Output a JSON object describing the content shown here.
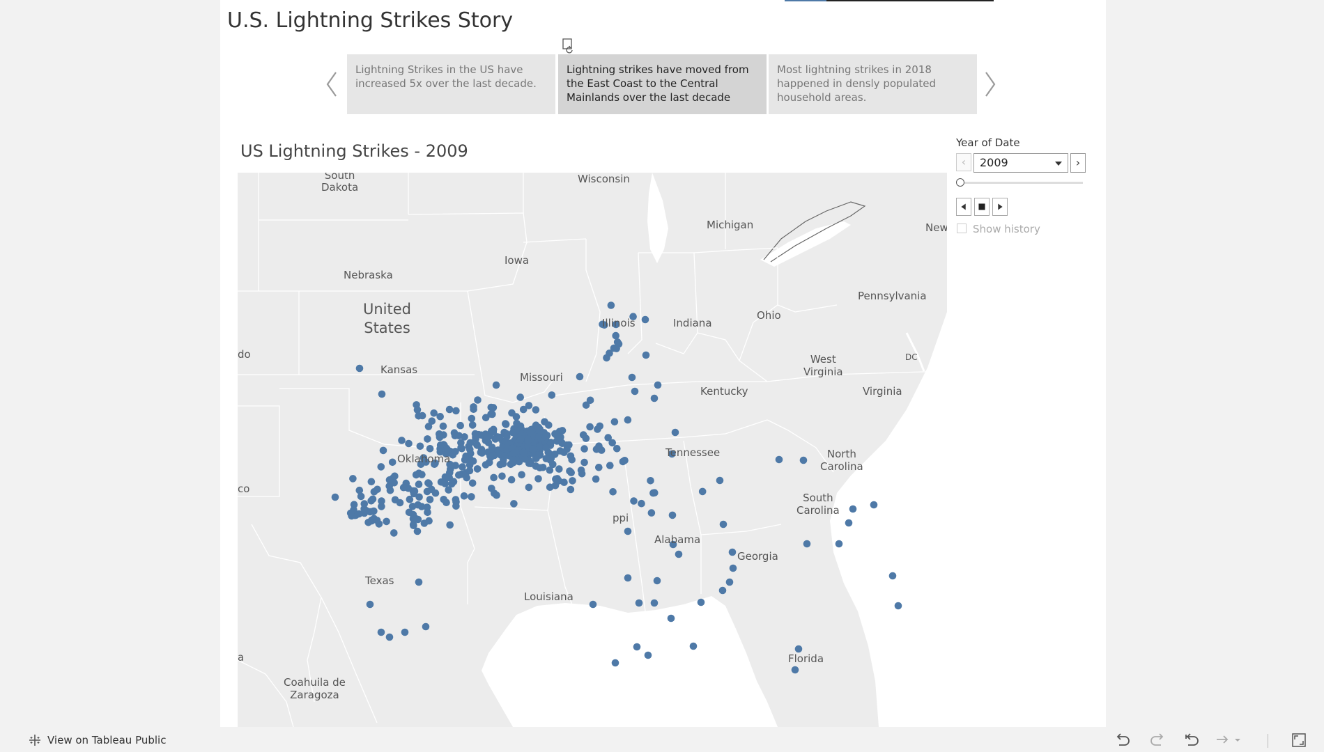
{
  "story": {
    "title": "U.S. Lightning Strikes Story",
    "progress_fraction": 0.2,
    "story_points": [
      {
        "text": "Lightning Strikes in the US have increased 5x over the last decade.",
        "active": false
      },
      {
        "text": "Lightning strikes have moved from the East Coast to the Central Mainlands over the last decade",
        "active": true
      },
      {
        "text": "Most lightning strikes in 2018 happened in densly populated household areas.",
        "active": false
      }
    ]
  },
  "sheet": {
    "title": "US Lightning Strikes - 2009",
    "marker_color": "#4e79a7"
  },
  "map_labels": {
    "south_dakota": "South\nDakota",
    "wisconsin": "Wisconsin",
    "michigan": "Michigan",
    "new_york": "New",
    "iowa": "Iowa",
    "nebraska": "Nebraska",
    "united_states": "United\nStates",
    "pennsylvania": "Pennsylvania",
    "illinois": "Illinois",
    "indiana": "Indiana",
    "ohio": "Ohio",
    "colorado": "do",
    "kansas": "Kansas",
    "missouri": "Missouri",
    "west_virginia": "West\nVirginia",
    "dc": "DC",
    "kentucky": "Kentucky",
    "virginia": "Virginia",
    "tennessee": "Tennessee",
    "north_carolina": "North\nCarolina",
    "oklahoma": "Oklahoma",
    "new_mexico": "co",
    "south_carolina": "South\nCarolina",
    "mississippi": "ppi",
    "alabama": "Alabama",
    "georgia": "Georgia",
    "texas": "Texas",
    "louisiana": "Louisiana",
    "florida": "Florida",
    "arizona": "a",
    "coahuila": "Coahuila de\nZaragoza"
  },
  "filter": {
    "label": "Year of Date",
    "value": "2009",
    "prev_symbol": "‹",
    "next_symbol": "›",
    "slider_fraction": 0,
    "show_history_label": "Show history",
    "show_history_checked": false
  },
  "footer": {
    "tableau_label": "View on Tableau Public"
  },
  "icons": {
    "prev": "chevron-left-icon",
    "next": "chevron-right-icon",
    "undo": "undo-icon",
    "redo": "redo-icon",
    "revert": "revert-icon",
    "share": "share-icon",
    "fullscreen": "fullscreen-icon"
  }
}
